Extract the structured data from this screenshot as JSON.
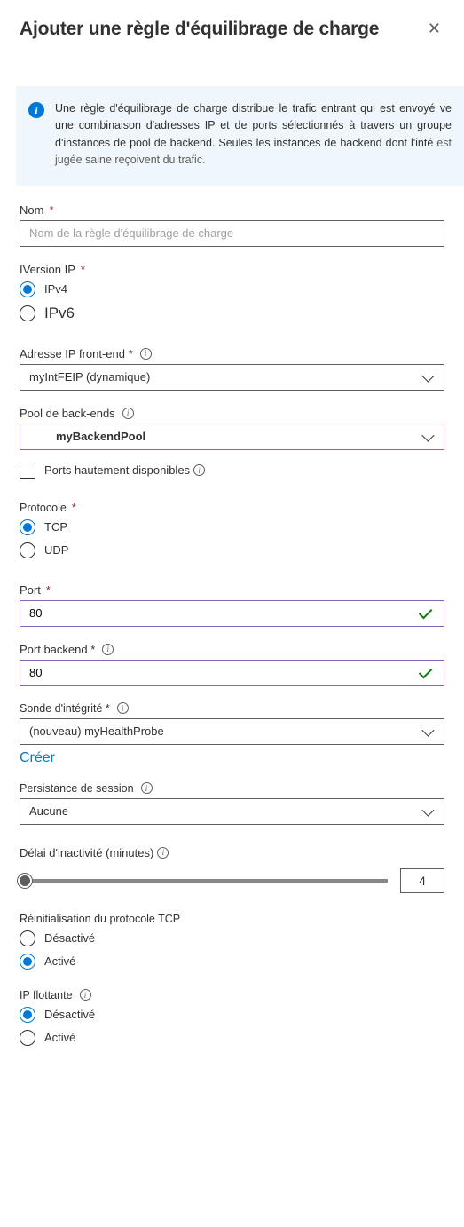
{
  "header": {
    "title": "Ajouter une règle d'équilibrage de charge"
  },
  "info_box": {
    "line1": "Une règle d'équilibrage de charge distribue le trafic entrant qui est envoyé ve",
    "line2": "une combinaison d'adresses IP et de ports sélectionnés à travers un groupe d'instances de pool de backend. Seules les instances de backend dont l'inté",
    "line3": "est jugée saine reçoivent du trafic."
  },
  "fields": {
    "name": {
      "label": "Nom",
      "placeholder": "Nom de la règle d'équilibrage de charge",
      "value": ""
    },
    "ip_version": {
      "label": "IVersion IP",
      "options": {
        "ipv4": "IPv4",
        "ipv6": "IPv6"
      },
      "selected": "ipv4"
    },
    "frontend_ip": {
      "label": "Adresse IP front-end *",
      "value": "myIntFEIP (dynamique)"
    },
    "backend_pool": {
      "label": "Pool de back-ends",
      "value": "myBackendPool"
    },
    "ha_ports": {
      "label": "Ports hautement disponibles",
      "checked": false
    },
    "protocol": {
      "label": "Protocole",
      "options": {
        "tcp": "TCP",
        "udp": "UDP"
      },
      "selected": "tcp"
    },
    "port": {
      "label": "Port",
      "value": "80"
    },
    "backend_port": {
      "label": "Port backend *",
      "value": "80"
    },
    "health_probe": {
      "label": "Sonde d'intégrité *",
      "value": "(nouveau) myHealthProbe",
      "create_link": "Créer"
    },
    "session_persistence": {
      "label": "Persistance de session",
      "value": "Aucune"
    },
    "idle_timeout": {
      "label": "Délai d'inactivité (minutes)",
      "value": "4"
    },
    "tcp_reset": {
      "label": "Réinitialisation du protocole TCP",
      "options": {
        "disabled": "Désactivé",
        "enabled": "Activé"
      },
      "selected": "enabled"
    },
    "floating_ip": {
      "label": "IP flottante",
      "options": {
        "disabled": "Désactivé",
        "enabled": "Activé"
      },
      "selected": "disabled"
    }
  }
}
